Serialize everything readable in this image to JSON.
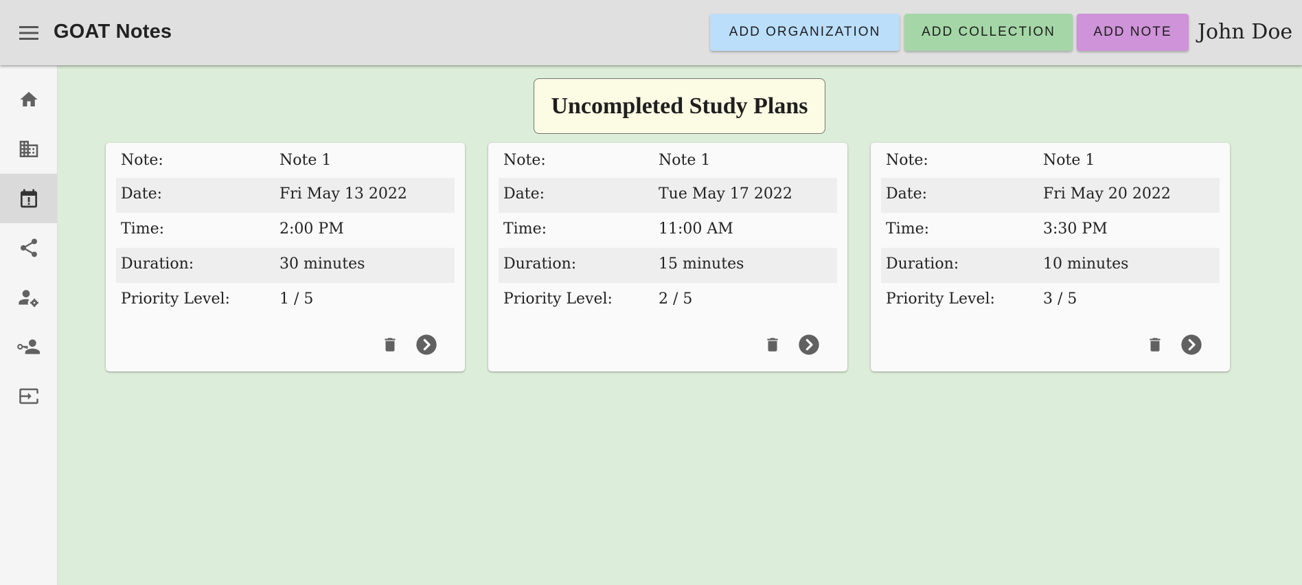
{
  "appbar": {
    "title": "GOAT Notes",
    "menu_icon": "hamburger-menu-icon",
    "buttons": {
      "add_organization": "ADD ORGANIZATION",
      "add_collection": "ADD COLLECTION",
      "add_note": "ADD NOTE"
    },
    "button_colors": {
      "add_organization": "#bbdefb",
      "add_collection": "#a5d6a7",
      "add_note": "#ce93d8"
    },
    "user_name": "John Doe"
  },
  "sidebar": {
    "items": [
      {
        "name": "home",
        "icon": "home-icon",
        "active": false
      },
      {
        "name": "organizations",
        "icon": "building-icon",
        "active": false
      },
      {
        "name": "study-plans",
        "icon": "calendar-alert-icon",
        "active": true
      },
      {
        "name": "shared",
        "icon": "share-icon",
        "active": false
      },
      {
        "name": "user-settings",
        "icon": "user-gear-icon",
        "active": false
      },
      {
        "name": "user-access",
        "icon": "user-key-icon",
        "active": false
      },
      {
        "name": "logout",
        "icon": "exit-icon",
        "active": false
      }
    ]
  },
  "main": {
    "heading": "Uncompleted Study Plans",
    "labels": {
      "note": "Note:",
      "date": "Date:",
      "time": "Time:",
      "duration": "Duration:",
      "priority": "Priority Level:"
    },
    "cards": [
      {
        "note": "Note 1",
        "date": "Fri May 13 2022",
        "time": "2:00 PM",
        "duration": "30 minutes",
        "priority": "1 / 5"
      },
      {
        "note": "Note 1",
        "date": "Tue May 17 2022",
        "time": "11:00 AM",
        "duration": "15 minutes",
        "priority": "2 / 5"
      },
      {
        "note": "Note 1",
        "date": "Fri May 20 2022",
        "time": "3:30 PM",
        "duration": "10 minutes",
        "priority": "3 / 5"
      }
    ],
    "card_action_icons": [
      "trash-icon",
      "chevron-right-circle-icon"
    ]
  },
  "colors": {
    "background": "#dcedd9",
    "appbar": "#e0e0e0",
    "heading_box": "#fcfbe3",
    "icon": "#616161"
  }
}
